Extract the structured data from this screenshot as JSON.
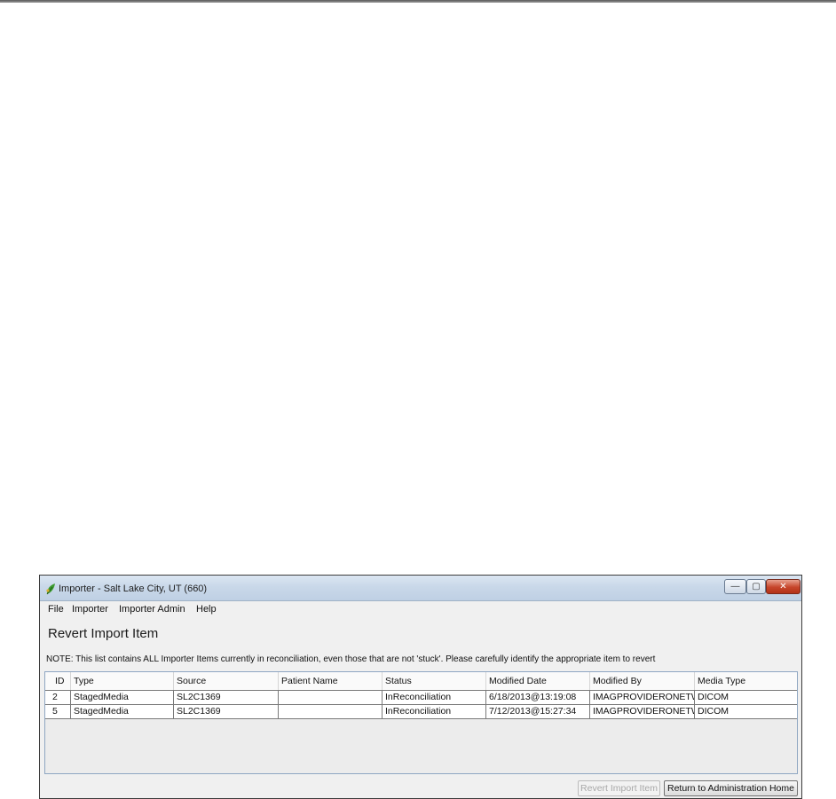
{
  "window": {
    "title": "Importer - Salt Lake City, UT (660)",
    "minimize_glyph": "—",
    "maximize_glyph": "▢",
    "close_glyph": "✕"
  },
  "menu": {
    "items": [
      "File",
      "Importer",
      "Importer Admin",
      "Help"
    ]
  },
  "page": {
    "title": "Revert Import Item",
    "note": "NOTE: This list contains ALL Importer Items currently in reconciliation, even those that are not 'stuck'. Please carefully identify the appropriate item to revert"
  },
  "table": {
    "columns": [
      "ID",
      "Type",
      "Source",
      "Patient Name",
      "Status",
      "Modified Date",
      "Modified By",
      "Media Type"
    ],
    "rows": [
      [
        "2",
        "StagedMedia",
        "SL2C1369",
        "",
        "InReconciliation",
        "6/18/2013@13:19:08",
        "IMAGPROVIDERONETWO",
        "DICOM"
      ],
      [
        "5",
        "StagedMedia",
        "SL2C1369",
        "",
        "InReconciliation",
        "7/12/2013@15:27:34",
        "IMAGPROVIDERONETWO",
        "DICOM"
      ]
    ]
  },
  "buttons": {
    "revert": "Revert Import Item",
    "revert_enabled": false,
    "return_home": "Return to Administration Home"
  },
  "colors": {
    "title_bar": "#c9d8e9",
    "close_button": "#c6452a",
    "window_background": "#f0f0f0",
    "grid_border": "#8ea6c2"
  },
  "icons": {
    "app": "leaf-icon",
    "minimize": "minimize-icon",
    "maximize": "maximize-icon",
    "close": "close-icon"
  }
}
